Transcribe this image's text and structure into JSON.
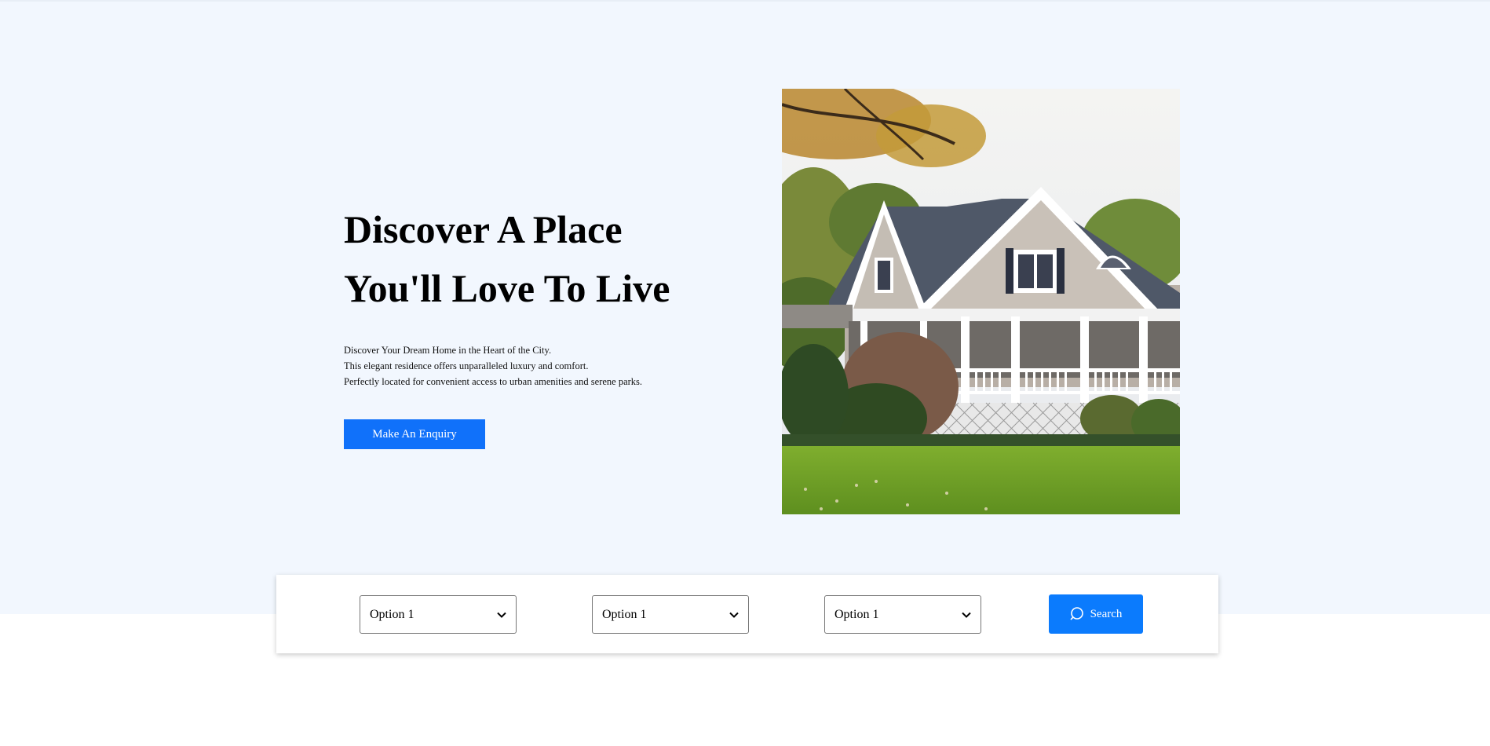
{
  "hero": {
    "title_line1": "Discover A Place",
    "title_line2": "You'll Love To Live",
    "description": [
      "Discover Your Dream Home in the Heart of the City.",
      "This elegant residence offers unparalleled luxury and comfort.",
      "Perfectly located for convenient access to urban amenities and serene parks."
    ],
    "enquiry_label": "Make An Enquiry",
    "image_icon": "house-photo"
  },
  "search": {
    "selects": [
      {
        "value": "Option 1"
      },
      {
        "value": "Option 1"
      },
      {
        "value": "Option 1"
      }
    ],
    "button_label": "Search",
    "button_icon": "search-icon"
  },
  "colors": {
    "hero_background": "#f2f7fe",
    "primary_button": "#1071fa",
    "search_button": "#0b7bfd"
  }
}
